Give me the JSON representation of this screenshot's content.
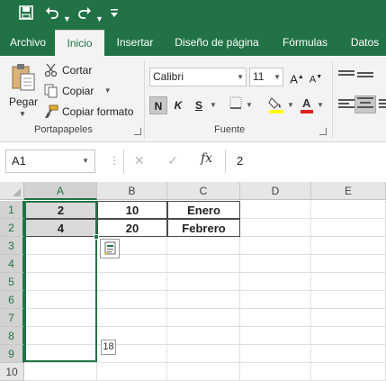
{
  "quick_access": {
    "icons": [
      "save-icon",
      "undo-icon",
      "undo-dropdown-icon",
      "redo-icon",
      "redo-dropdown-icon",
      "customize-qat-icon"
    ]
  },
  "tabs": [
    {
      "label": "Archivo",
      "active": false
    },
    {
      "label": "Inicio",
      "active": true
    },
    {
      "label": "Insertar",
      "active": false
    },
    {
      "label": "Diseño de página",
      "active": false
    },
    {
      "label": "Fórmulas",
      "active": false
    },
    {
      "label": "Datos",
      "active": false
    }
  ],
  "ribbon": {
    "clipboard": {
      "paste_label": "Pegar",
      "cut_label": "Cortar",
      "copy_label": "Copiar",
      "format_painter_label": "Copiar formato",
      "group_label": "Portapapeles"
    },
    "font": {
      "font_name": "Calibri",
      "font_size": "11",
      "bold_label": "N",
      "italic_label": "K",
      "underline_label": "S",
      "group_label": "Fuente",
      "fill_color": "#ffff00",
      "font_color": "#e02020"
    }
  },
  "formula_bar": {
    "name_box": "A1",
    "fx_label": "fx",
    "value": "2"
  },
  "grid": {
    "columns": [
      "A",
      "B",
      "C",
      "D",
      "E"
    ],
    "rows": [
      "1",
      "2",
      "3",
      "4",
      "5",
      "6",
      "7",
      "8",
      "9",
      "10"
    ],
    "cells": {
      "A1": "2",
      "B1": "10",
      "C1": "Enero",
      "A2": "4",
      "B2": "20",
      "C2": "Febrero"
    },
    "selected_range": "A1:A9",
    "autofill_tooltip": "18"
  },
  "colors": {
    "accent": "#217346",
    "selection_shade": "#d9d9d9"
  }
}
